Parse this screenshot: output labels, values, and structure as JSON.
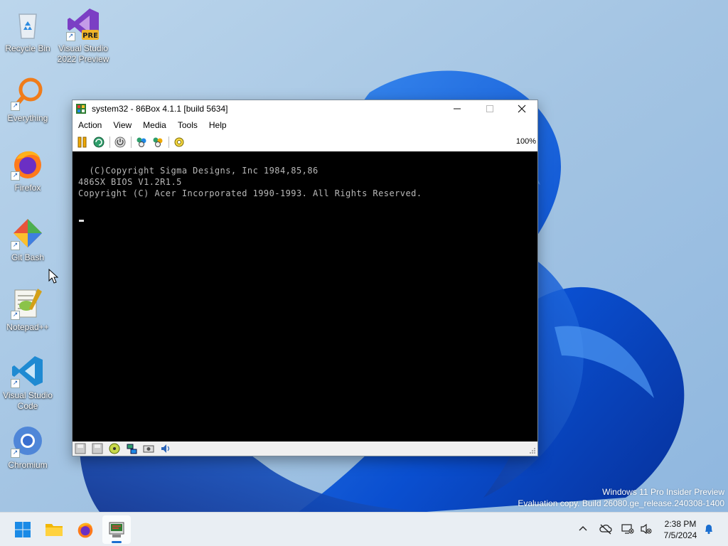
{
  "desktop": {
    "icons": [
      {
        "label": "Recycle Bin"
      },
      {
        "label": "Visual Studio 2022 Preview",
        "badge": "PRE"
      },
      {
        "label": "Everything"
      },
      {
        "label": "Firefox"
      },
      {
        "label": "Git Bash"
      },
      {
        "label": "Notepad++"
      },
      {
        "label": "Visual Studio Code"
      },
      {
        "label": "Chromium"
      }
    ]
  },
  "window": {
    "title": "system32 - 86Box 4.1.1 [build 5634]",
    "menu": [
      "Action",
      "View",
      "Media",
      "Tools",
      "Help"
    ],
    "zoom": "100%",
    "screen_lines": [
      "  (C)Copyright Sigma Designs, Inc 1984,85,86",
      "486SX BIOS V1.2R1.5",
      "Copyright (C) Acer Incorporated 1990-1993. All Rights Reserved."
    ]
  },
  "watermark": {
    "line1": "Windows 11 Pro Insider Preview",
    "line2": "Evaluation copy. Build 26080.ge_release.240308-1400"
  },
  "taskbar": {
    "time": "2:38 PM",
    "date": "7/5/2024"
  },
  "colors": {
    "accent": "#1a6ed0",
    "screen_bg": "#000000",
    "screen_text": "#b8b8b8"
  }
}
